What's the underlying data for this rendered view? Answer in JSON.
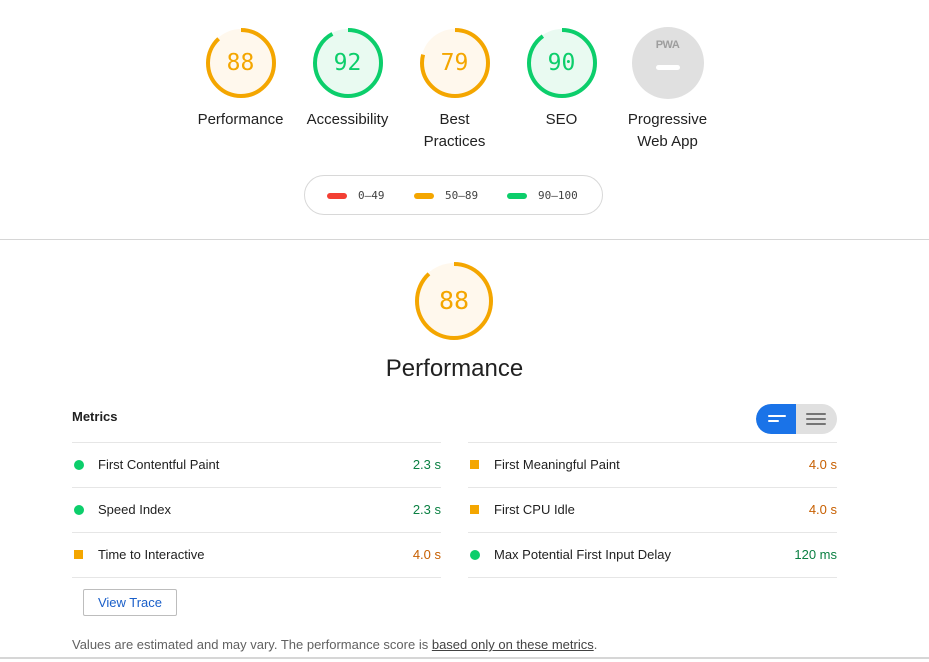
{
  "summary": {
    "gauges": [
      {
        "score": "88",
        "label": "Performance",
        "color": "#f4a600",
        "fill": 0.88
      },
      {
        "score": "92",
        "label": "Accessibility",
        "color": "#0cce6b",
        "fill": 0.92
      },
      {
        "score": "79",
        "label": "Best Practices",
        "color": "#f4a600",
        "fill": 0.79
      },
      {
        "score": "90",
        "label": "SEO",
        "color": "#0cce6b",
        "fill": 0.9
      }
    ],
    "pwa": {
      "badge_text": "PWA",
      "label": "Progressive Web App"
    }
  },
  "legend": [
    {
      "range": "0–49",
      "color": "#f33f33"
    },
    {
      "range": "50–89",
      "color": "#f4a600"
    },
    {
      "range": "90–100",
      "color": "#0cce6b"
    }
  ],
  "performance": {
    "score": "88",
    "fill": 0.88,
    "color": "#f4a600",
    "title": "Performance",
    "metrics_label": "Metrics",
    "metrics_left": [
      {
        "name": "First Contentful Paint",
        "value": "2.3 s",
        "status": "pass"
      },
      {
        "name": "Speed Index",
        "value": "2.3 s",
        "status": "pass"
      },
      {
        "name": "Time to Interactive",
        "value": "4.0 s",
        "status": "average"
      }
    ],
    "metrics_right": [
      {
        "name": "First Meaningful Paint",
        "value": "4.0 s",
        "status": "average"
      },
      {
        "name": "First CPU Idle",
        "value": "4.0 s",
        "status": "average"
      },
      {
        "name": "Max Potential First Input Delay",
        "value": "120 ms",
        "status": "pass"
      }
    ],
    "view_trace_label": "View Trace",
    "footnote_text": "Values are estimated and may vary. The performance score is ",
    "footnote_link": "based only on these metrics",
    "footnote_end": "."
  },
  "colors": {
    "pass": "#0cce6b",
    "average": "#f4a600",
    "fail": "#f33f33",
    "toggle_active": "#1a73e8"
  }
}
